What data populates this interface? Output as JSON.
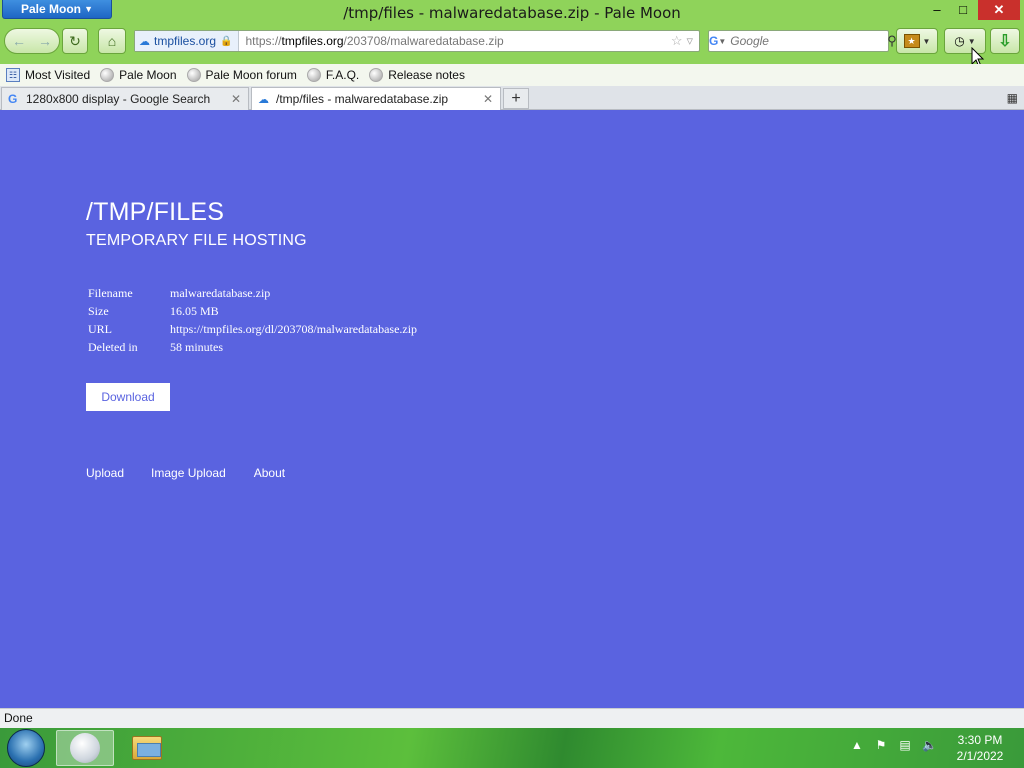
{
  "window": {
    "app_menu": "Pale Moon",
    "title": "/tmp/files - malwaredatabase.zip - Pale Moon",
    "minimize": "–",
    "maximize": "□",
    "close": "✕"
  },
  "navbar": {
    "back_icon": "←",
    "forward_icon": "→",
    "reload_icon": "↻",
    "home_icon": "⌂",
    "identity_label": "tmpfiles.org",
    "url_prefix": "https://",
    "url_host": "tmpfiles.org",
    "url_path": "/203708/malwaredatabase.zip",
    "search_engine_letter": "G",
    "search_placeholder": "Google"
  },
  "bookmarks_bar": {
    "items": [
      {
        "label": "Most Visited"
      },
      {
        "label": "Pale Moon"
      },
      {
        "label": "Pale Moon forum"
      },
      {
        "label": "F.A.Q."
      },
      {
        "label": "Release notes"
      }
    ]
  },
  "tabs": [
    {
      "label": "1280x800 display - Google Search",
      "favicon": "G"
    },
    {
      "label": "/tmp/files - malwaredatabase.zip",
      "favicon": "cloud"
    }
  ],
  "page": {
    "title": "/TMP/FILES",
    "subtitle": "TEMPORARY FILE HOSTING",
    "info": [
      {
        "key": "Filename",
        "value": "malwaredatabase.zip"
      },
      {
        "key": "Size",
        "value": "16.05 MB"
      },
      {
        "key": "URL",
        "value": "https://tmpfiles.org/dl/203708/malwaredatabase.zip"
      },
      {
        "key": "Deleted in",
        "value": "58 minutes"
      }
    ],
    "download_label": "Download",
    "footer_links": [
      "Upload",
      "Image Upload",
      "About"
    ],
    "background_color": "#5a63e0"
  },
  "statusbar": {
    "text": "Done"
  },
  "taskbar": {
    "time": "3:30 PM",
    "date": "2/1/2022"
  }
}
